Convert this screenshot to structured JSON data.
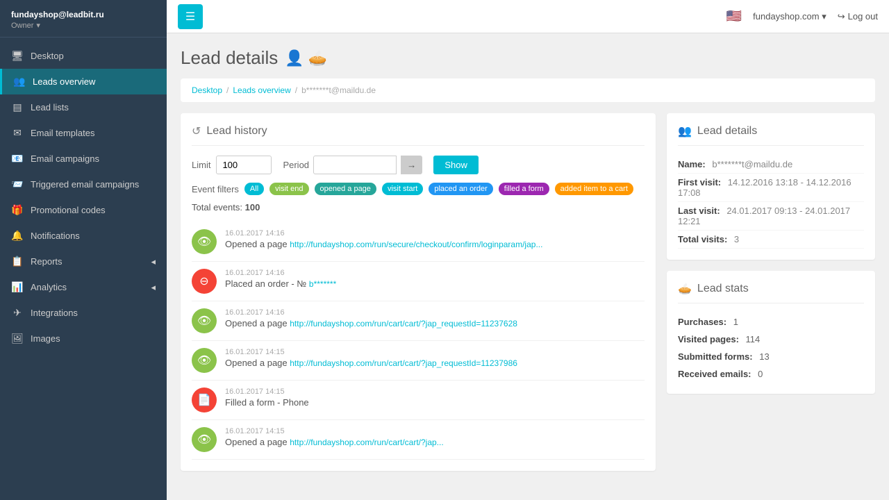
{
  "sidebar": {
    "username": "fundayshop@leadbit.ru",
    "role": "Owner",
    "items": [
      {
        "id": "desktop",
        "label": "Desktop",
        "icon": "🖥",
        "active": false
      },
      {
        "id": "leads-overview",
        "label": "Leads overview",
        "icon": "👥",
        "active": true
      },
      {
        "id": "lead-lists",
        "label": "Lead lists",
        "icon": "≡",
        "active": false
      },
      {
        "id": "email-templates",
        "label": "Email templates",
        "icon": "✉",
        "active": false
      },
      {
        "id": "email-campaigns",
        "label": "Email campaigns",
        "icon": "📧",
        "active": false
      },
      {
        "id": "triggered-email",
        "label": "Triggered email campaigns",
        "icon": "📨",
        "active": false
      },
      {
        "id": "promotional-codes",
        "label": "Promotional codes",
        "icon": "🎁",
        "active": false
      },
      {
        "id": "notifications",
        "label": "Notifications",
        "icon": "🔔",
        "active": false
      },
      {
        "id": "reports",
        "label": "Reports",
        "icon": "📋",
        "active": false,
        "arrow": true
      },
      {
        "id": "analytics",
        "label": "Analytics",
        "icon": "📊",
        "active": false,
        "arrow": true
      },
      {
        "id": "integrations",
        "label": "Integrations",
        "icon": "✈",
        "active": false
      },
      {
        "id": "images",
        "label": "Images",
        "icon": "🖼",
        "active": false
      }
    ]
  },
  "topbar": {
    "menu_btn_label": "☰",
    "flag": "🇺🇸",
    "domain": "fundayshop.com",
    "logout_label": "Log out"
  },
  "breadcrumb": {
    "desktop": "Desktop",
    "leads_overview": "Leads overview",
    "email": "b*******t@maildu.de"
  },
  "page": {
    "title": "Lead details"
  },
  "lead_history": {
    "section_title": "Lead history",
    "limit_label": "Limit",
    "limit_value": "100",
    "period_label": "Period",
    "period_from": "",
    "period_to": "",
    "show_btn": "Show",
    "event_filters_label": "Event filters",
    "filter_all": "All",
    "filters": [
      {
        "id": "visit-end",
        "label": "visit end",
        "color": "green"
      },
      {
        "id": "opened-a-page",
        "label": "opened a page",
        "color": "teal"
      },
      {
        "id": "visit-start",
        "label": "visit start",
        "color": "cyan"
      },
      {
        "id": "placed-an-order",
        "label": "placed an order",
        "color": "blue"
      },
      {
        "id": "filled-a-form",
        "label": "filled a form",
        "color": "purple"
      },
      {
        "id": "added-item-to-cart",
        "label": "added item to a cart",
        "color": "orange"
      }
    ],
    "total_events_label": "Total events:",
    "total_events_value": "100",
    "events": [
      {
        "id": "e1",
        "time": "16.01.2017 14:16",
        "type": "opened-a-page",
        "icon": "eye",
        "text": "Opened a page",
        "link": "http://fundayshop.com/run/secure/checkout/confirm/loginparam/jap..."
      },
      {
        "id": "e2",
        "time": "16.01.2017 14:16",
        "type": "placed-an-order",
        "icon": "order",
        "text": "Placed an order - №",
        "link": "b*******"
      },
      {
        "id": "e3",
        "time": "16.01.2017 14:16",
        "type": "opened-a-page",
        "icon": "eye",
        "text": "Opened a page",
        "link": "http://fundayshop.com/run/cart/cart/?jap_requestId=11237628"
      },
      {
        "id": "e4",
        "time": "16.01.2017 14:15",
        "type": "opened-a-page",
        "icon": "eye",
        "text": "Opened a page",
        "link": "http://fundayshop.com/run/cart/cart/?jap_requestId=11237986"
      },
      {
        "id": "e5",
        "time": "16.01.2017 14:15",
        "type": "filled-a-form",
        "icon": "form",
        "text": "Filled a form - Phone"
      },
      {
        "id": "e6",
        "time": "16.01.2017 14:15",
        "type": "opened-a-page",
        "icon": "eye",
        "text": "Opened a page",
        "link": "http://fundayshop.com/run/cart/cart/?jap..."
      }
    ]
  },
  "lead_details": {
    "section_title": "Lead details",
    "name_label": "Name:",
    "name_value": "b*******t@maildu.de",
    "first_visit_label": "First visit:",
    "first_visit_value": "14.12.2016 13:18 - 14.12.2016 17:08",
    "last_visit_label": "Last visit:",
    "last_visit_value": "24.01.2017 09:13 - 24.01.2017 12:21",
    "total_visits_label": "Total visits:",
    "total_visits_value": "3"
  },
  "lead_stats": {
    "section_title": "Lead stats",
    "purchases_label": "Purchases:",
    "purchases_value": "1",
    "visited_pages_label": "Visited pages:",
    "visited_pages_value": "114",
    "submitted_forms_label": "Submitted forms:",
    "submitted_forms_value": "13",
    "received_emails_label": "Received emails:",
    "received_emails_value": "0"
  }
}
